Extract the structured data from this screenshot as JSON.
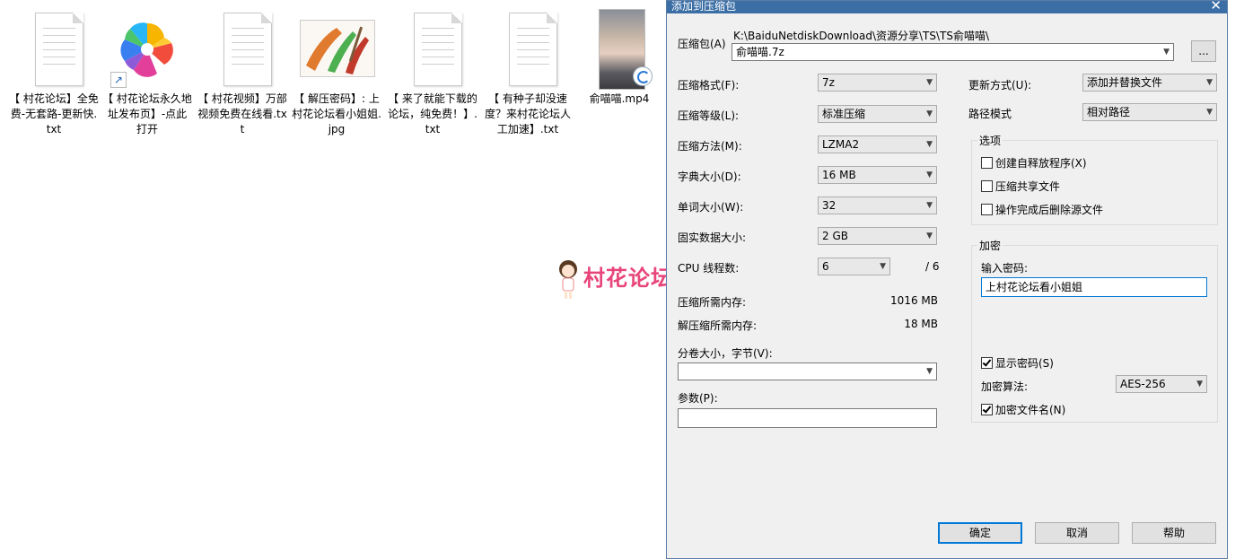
{
  "desktop": {
    "files": [
      {
        "name": "【 村花论坛】全免费-无套路-更新快.txt",
        "kind": "txt"
      },
      {
        "name": "【 村花论坛永久地址发布页】-点此打开",
        "kind": "shortcut"
      },
      {
        "name": "【 村花视频】万部视频免费在线看.txt",
        "kind": "txt"
      },
      {
        "name": "【 解压密码】: 上村花论坛看小姐姐.jpg",
        "kind": "image"
      },
      {
        "name": "【 来了就能下载的论坛，纯免费！】.txt",
        "kind": "txt"
      },
      {
        "name": "【 有种子却没速度？来村花论坛人工加速】.txt",
        "kind": "txt"
      },
      {
        "name": "俞喵喵.mp4",
        "kind": "video"
      }
    ],
    "watermark": "村花论坛"
  },
  "dialog": {
    "title": "添加到压缩包",
    "archive_label": "压缩包(A)",
    "archive_path": "K:\\BaiduNetdiskDownload\\资源分享\\TS\\TS俞喵喵\\",
    "archive_name": "俞喵喵.7z",
    "browse_label": "...",
    "format_label": "压缩格式(F):",
    "format_value": "7z",
    "level_label": "压缩等级(L):",
    "level_value": "标准压缩",
    "method_label": "压缩方法(M):",
    "method_value": "LZMA2",
    "dict_label": "字典大小(D):",
    "dict_value": "16 MB",
    "word_label": "单词大小(W):",
    "word_value": "32",
    "solid_label": "固实数据大小:",
    "solid_value": "2 GB",
    "cpu_label": "CPU 线程数:",
    "cpu_value": "6",
    "cpu_total": "/ 6",
    "mem_comp_label": "压缩所需内存:",
    "mem_comp_value": "1016 MB",
    "mem_decomp_label": "解压缩所需内存:",
    "mem_decomp_value": "18 MB",
    "volume_label": "分卷大小，字节(V):",
    "volume_value": "",
    "params_label": "参数(P):",
    "params_value": "",
    "update_label": "更新方式(U):",
    "update_value": "添加并替换文件",
    "path_label": "路径模式",
    "path_value": "相对路径",
    "options_title": "选项",
    "opt_sfx": "创建自释放程序(X)",
    "opt_shared": "压缩共享文件",
    "opt_delete": "操作完成后删除源文件",
    "encrypt_title": "加密",
    "password_label": "输入密码:",
    "password_value": "上村花论坛看小姐姐",
    "show_password": "显示密码(S)",
    "enc_method_label": "加密算法:",
    "enc_method_value": "AES-256",
    "encrypt_names": "加密文件名(N)",
    "ok": "确定",
    "cancel": "取消",
    "help": "帮助"
  }
}
